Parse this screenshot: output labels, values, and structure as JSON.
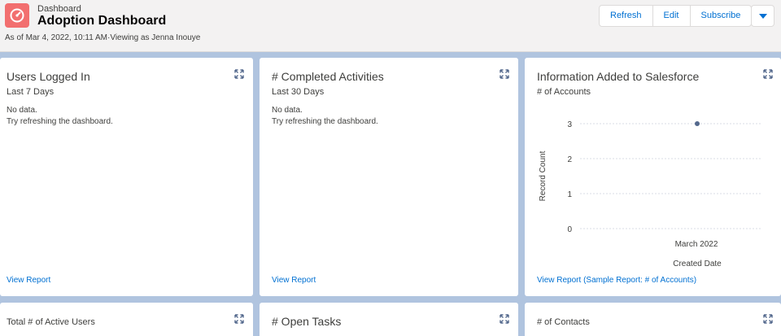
{
  "header": {
    "eyebrow": "Dashboard",
    "title": "Adoption Dashboard",
    "meta": "As of Mar 4, 2022, 10:11 AM·Viewing as Jenna Inouye",
    "buttons": {
      "refresh": "Refresh",
      "edit": "Edit",
      "subscribe": "Subscribe"
    }
  },
  "cards": {
    "users_logged_in": {
      "title": "Users Logged In",
      "subtitle": "Last 7 Days",
      "no_data": "No data.",
      "hint": "Try refreshing the dashboard.",
      "footer": "View Report"
    },
    "completed_activities": {
      "title": "# Completed Activities",
      "subtitle": "Last 30 Days",
      "no_data": "No data.",
      "hint": "Try refreshing the dashboard.",
      "footer": "View Report"
    },
    "info_added": {
      "title": "Information Added to Salesforce",
      "subtitle": "# of Accounts",
      "footer": "View Report (Sample Report: # of Accounts)"
    },
    "total_active_users": {
      "title": "Total # of Active Users"
    },
    "open_tasks": {
      "title": "# Open Tasks"
    },
    "contacts": {
      "title": "# of Contacts"
    }
  },
  "chart_data": {
    "type": "line",
    "categories": [
      "March 2022"
    ],
    "series": [
      {
        "values": [
          3
        ]
      }
    ],
    "xlabel": "Created Date",
    "ylabel": "Record Count",
    "yticks": [
      0,
      1,
      2,
      3
    ],
    "ylim": [
      0,
      3
    ],
    "grid": true,
    "color": "#54698d"
  },
  "colors": {
    "background": "#b0c4df",
    "link": "#0070d2",
    "app_icon": "#f26f6f"
  }
}
